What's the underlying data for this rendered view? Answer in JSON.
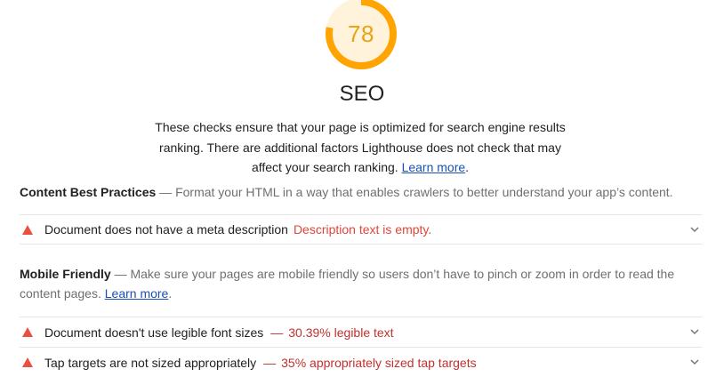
{
  "score": {
    "value": "78",
    "fraction": 0.78,
    "color": "#ffa400",
    "track_color": "#fff3dc"
  },
  "category": {
    "title": "SEO",
    "description": "These checks ensure that your page is optimized for search engine results ranking. There are additional factors Lighthouse does not check that may affect your search ranking.",
    "learn_more": "Learn more",
    "trailing": "."
  },
  "groups": {
    "content": {
      "title": "Content Best Practices",
      "separator": "—",
      "description": "Format your HTML in a way that enables crawlers to better understand your app’s content."
    },
    "mobile": {
      "title": "Mobile Friendly",
      "separator": "—",
      "description": "Make sure your pages are mobile friendly so users don’t have to pinch or zoom in order to read the content pages.",
      "learn_more": "Learn more",
      "trailing": "."
    }
  },
  "audits": {
    "meta_description": {
      "title": "Document does not have a meta description",
      "display": "Description text is empty."
    },
    "font_size": {
      "title": "Document doesn't use legible font sizes",
      "separator": "—",
      "display": "30.39% legible text"
    },
    "tap_targets": {
      "title": "Tap targets are not sized appropriately",
      "separator": "—",
      "display": "35% appropriately sized tap targets"
    }
  },
  "colors": {
    "fail": "#eb4f42",
    "fail_text": "#c3302d",
    "link": "#1a50b5",
    "divider": "#e6e6e6"
  }
}
